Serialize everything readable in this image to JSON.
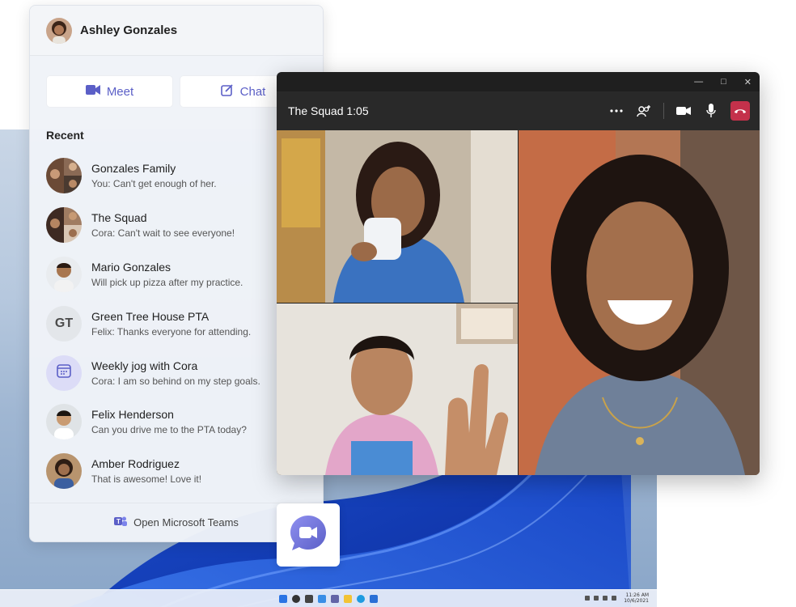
{
  "user": {
    "name": "Ashley Gonzales"
  },
  "actions": {
    "meet_label": "Meet",
    "chat_label": "Chat"
  },
  "recent_title": "Recent",
  "chats": [
    {
      "name": "Gonzales Family",
      "preview": "You: Can't get enough of her.",
      "avatar": "group-photo"
    },
    {
      "name": "The Squad",
      "preview": "Cora: Can't wait to see everyone!",
      "avatar": "group-photo"
    },
    {
      "name": "Mario Gonzales",
      "preview": "Will pick up pizza after my practice.",
      "avatar": "person-photo"
    },
    {
      "name": "Green Tree House PTA",
      "preview": "Felix: Thanks everyone for attending.",
      "avatar_initials": "GT"
    },
    {
      "name": "Weekly jog with Cora",
      "preview": "Cora: I am so behind on my step goals.",
      "avatar": "calendar-icon"
    },
    {
      "name": "Felix Henderson",
      "preview": "Can you drive me to the PTA today?",
      "avatar": "person-photo"
    },
    {
      "name": "Amber Rodriguez",
      "preview": "That is awesome! Love it!",
      "avatar": "person-photo"
    }
  ],
  "footer": {
    "label": "Open Microsoft Teams"
  },
  "call": {
    "title": "The Squad 1:05"
  },
  "taskbar": {
    "time": "11:26 AM",
    "date": "10/6/2021"
  },
  "colors": {
    "accent": "#5b5fc7",
    "hangup": "#c4314b",
    "call_bg": "#1f1f1f"
  }
}
